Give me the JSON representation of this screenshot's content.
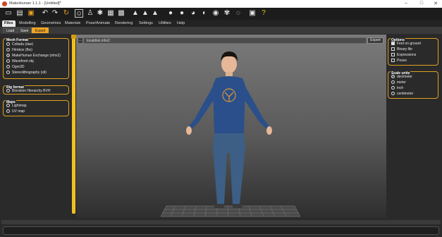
{
  "window": {
    "title": "MakeHuman 1.1.1 - [Untitled]*",
    "minimize": "–",
    "maximize": "□",
    "close": "✕"
  },
  "toolbar": {
    "icons": [
      "new-icon",
      "save-icon",
      "load-icon",
      "undo-icon",
      "redo-icon",
      "reset-icon",
      "smooth-icon",
      "wireframe-icon",
      "pose-icon",
      "grid-icon",
      "checker-icon",
      "front-view-icon",
      "back-view-icon",
      "side-view-icon",
      "top-view-icon",
      "skeleton-icon",
      "camera-icon",
      "help-icon"
    ]
  },
  "tabs": [
    "Files",
    "Modelling",
    "Geometries",
    "Materials",
    "Pose/Animate",
    "Rendering",
    "Settings",
    "Utilities",
    "Help"
  ],
  "active_tab": "Files",
  "subtabs": [
    "Load",
    "Save",
    "Export"
  ],
  "active_subtab": "Export",
  "left": {
    "mesh_format": {
      "title": "Mesh Format",
      "options": [
        {
          "label": "Collada (dae)",
          "selected": false
        },
        {
          "label": "Filmbox (fbx)",
          "selected": false
        },
        {
          "label": "MakeHuman Exchange (mhx2)",
          "selected": true
        },
        {
          "label": "Wavefront obj",
          "selected": false
        },
        {
          "label": "Ogre3D",
          "selected": false
        },
        {
          "label": "Stereolithography (stl)",
          "selected": false
        }
      ]
    },
    "rig_format": {
      "title": "Rig format",
      "options": [
        {
          "label": "Biovision Hierarchy BVH",
          "selected": false
        }
      ]
    },
    "maps": {
      "title": "Maps",
      "options": [
        {
          "label": "Lightmap",
          "selected": false
        },
        {
          "label": "UV map",
          "selected": false
        }
      ]
    }
  },
  "viewport": {
    "browse_label": "...",
    "path_value": "localdisk.mhx2",
    "export_label": "Export"
  },
  "right": {
    "options": {
      "title": "Options",
      "items": [
        {
          "label": "Feet on ground",
          "checked": true
        },
        {
          "label": "Binary file",
          "checked": false
        },
        {
          "label": "Expressions",
          "checked": false
        },
        {
          "label": "Poses",
          "checked": false
        }
      ]
    },
    "scale_units": {
      "title": "Scale units",
      "items": [
        {
          "label": "decimeter",
          "selected": true
        },
        {
          "label": "meter",
          "selected": false
        },
        {
          "label": "inch",
          "selected": false
        },
        {
          "label": "centimeter",
          "selected": false
        }
      ]
    }
  },
  "colors": {
    "accent": "#f0a526",
    "panel_border": "#e0a020",
    "shirt": "#2a4f8a",
    "jeans": "#3d5f86"
  }
}
